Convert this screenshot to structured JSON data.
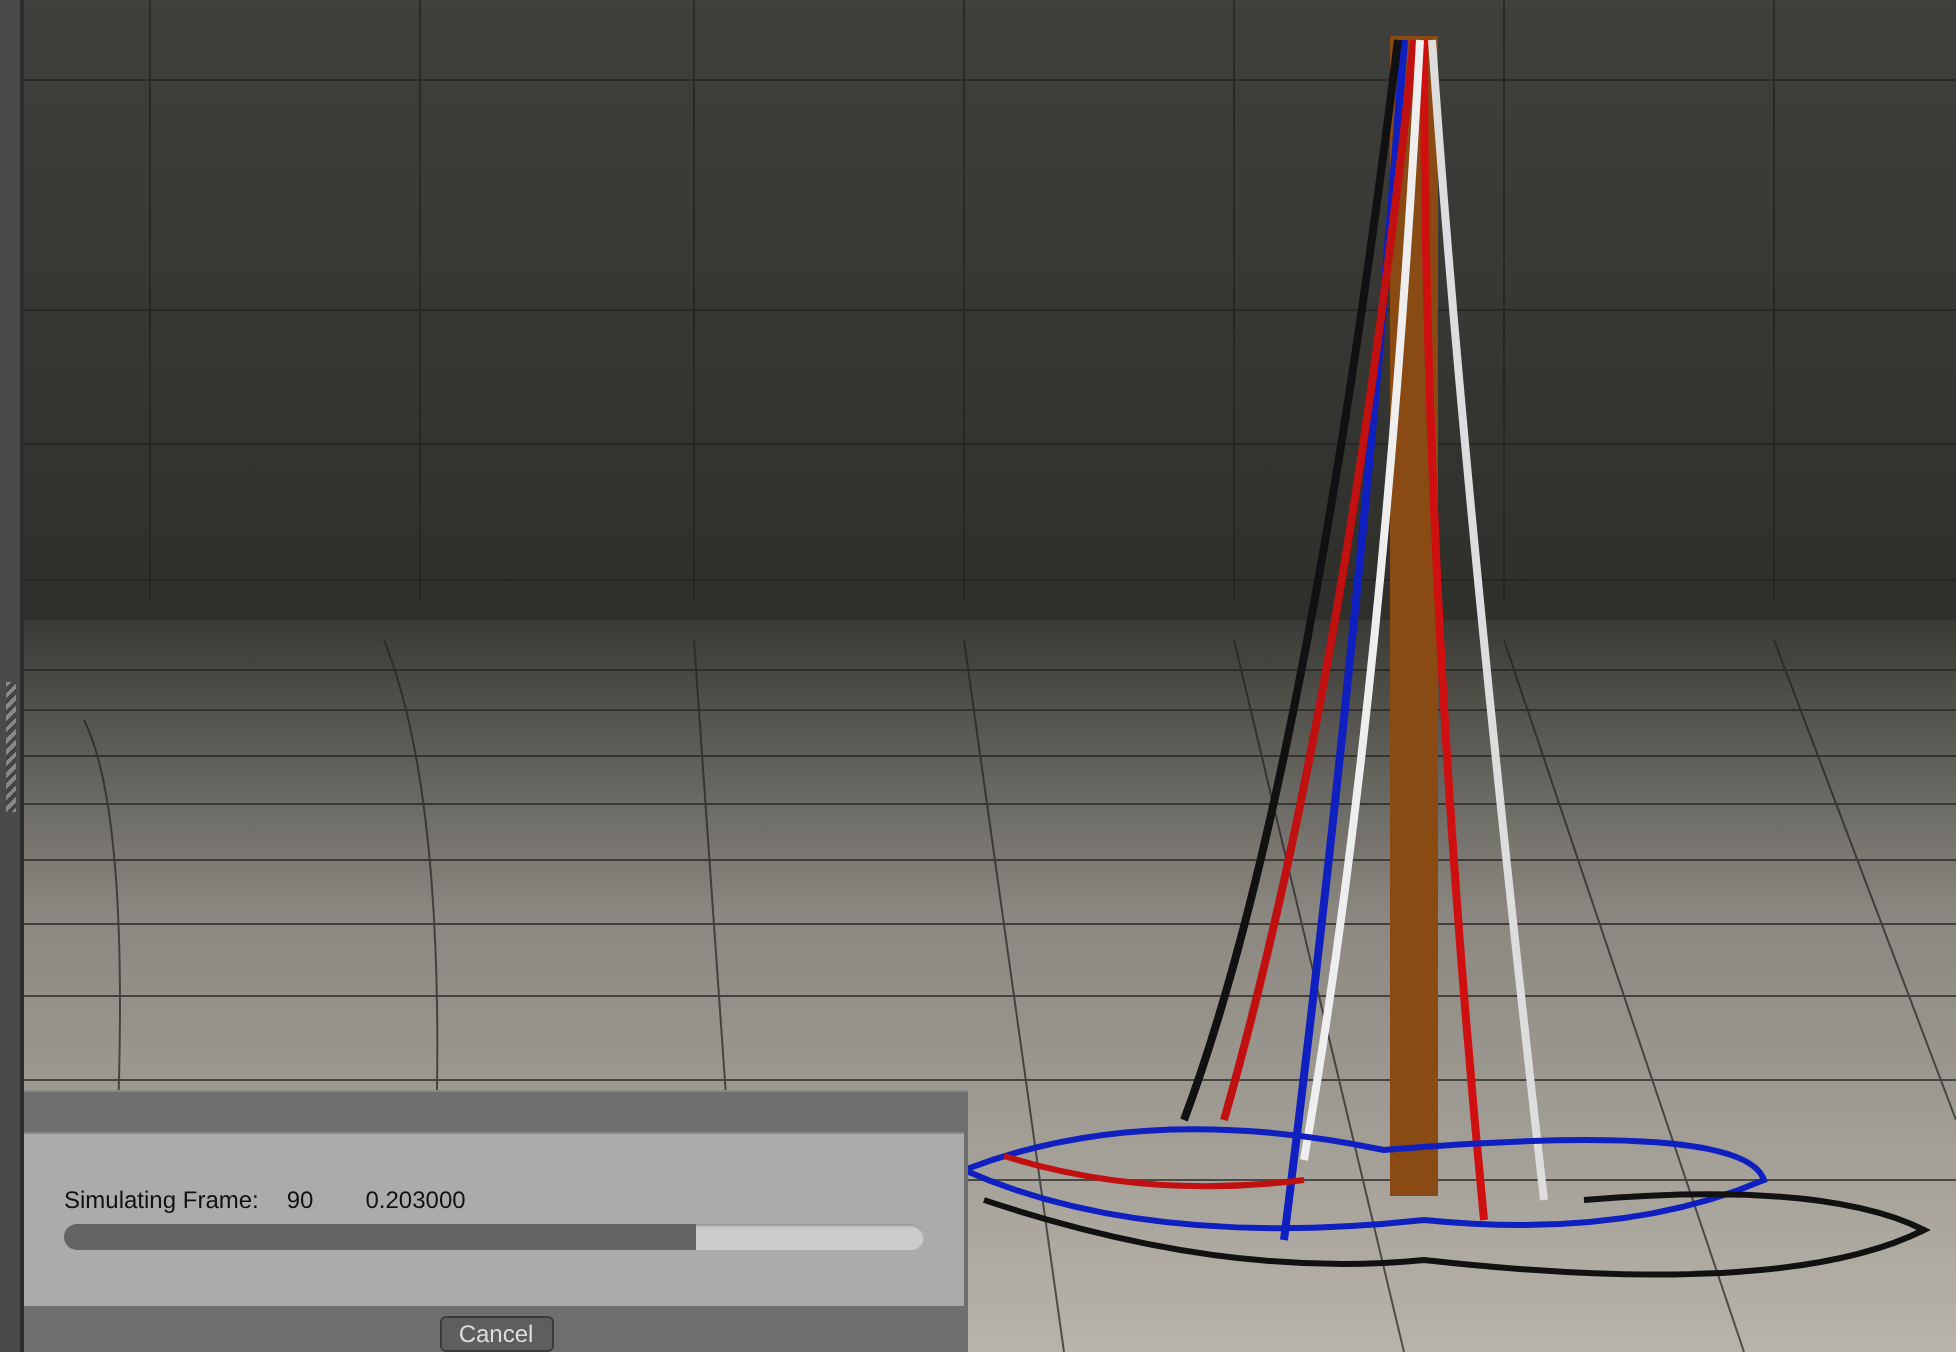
{
  "progress_dialog": {
    "label": "Simulating Frame:",
    "frame": "90",
    "value": "0.203000",
    "level": 0.736,
    "cancel_button": "Cancel"
  }
}
